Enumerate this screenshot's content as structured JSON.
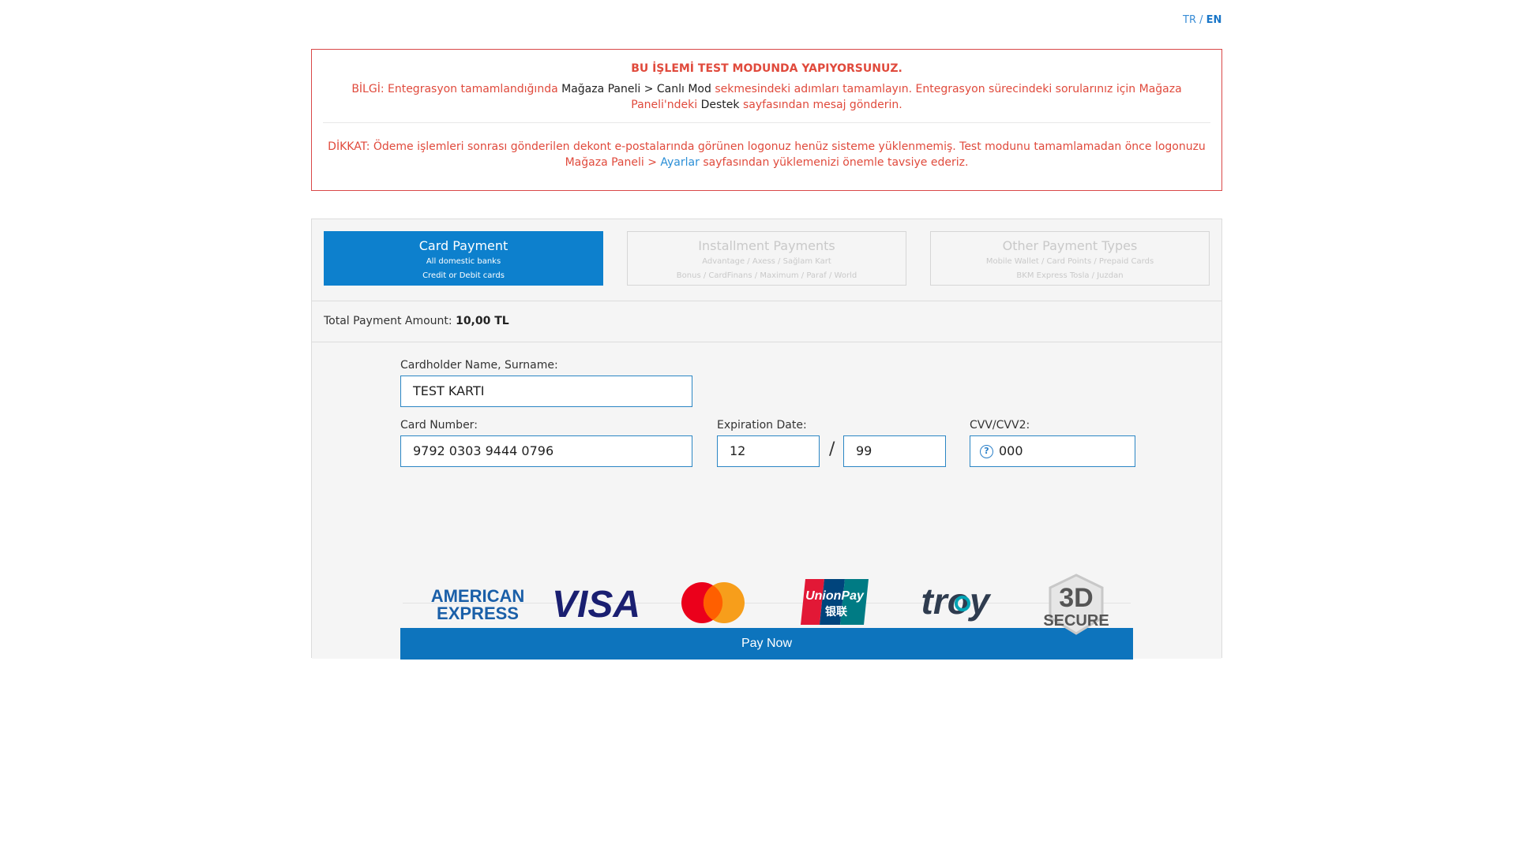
{
  "lang": {
    "tr": "TR",
    "sep": "/",
    "en": "EN"
  },
  "alert": {
    "title": "BU İŞLEMİ TEST MODUNDA YAPIYORSUNUZ.",
    "info_1": "BİLGİ: Entegrasyon tamamlandığında ",
    "info_link1": "Mağaza Paneli > Canlı Mod",
    "info_2": " sekmesindeki adımları tamamlayın. Entegrasyon sürecindeki sorularınız için Mağaza Paneli'ndeki ",
    "info_link2": "Destek",
    "info_3": " sayfasından mesaj gönderin.",
    "warn_1": "DİKKAT: Ödeme işlemleri sonrası gönderilen dekont e-postalarında görünen logonuz henüz sisteme yüklenmemiş. Test modunu tamamlamadan önce logonuzu Mağaza Paneli > ",
    "warn_link": "Ayarlar",
    "warn_2": " sayfasından yüklemenizi önemle tavsiye ederiz."
  },
  "tabs": [
    {
      "title": "Card Payment",
      "sub1": "All domestic banks",
      "sub2": "Credit or Debit cards"
    },
    {
      "title": "Installment Payments",
      "sub1": "Advantage / Axess / Sağlam Kart",
      "sub2": "Bonus / CardFinans / Maximum / Paraf / World"
    },
    {
      "title": "Other Payment Types",
      "sub1": "Mobile Wallet / Card Points / Prepaid Cards",
      "sub2": "BKM Express Tosla / Juzdan"
    }
  ],
  "amount": {
    "label": "Total Payment Amount:",
    "value": "10,00 TL"
  },
  "form": {
    "name_label": "Cardholder Name, Surname:",
    "name_value": "TEST KARTI",
    "card_label": "Card Number:",
    "card_value": "9792 0303 9444 0796",
    "exp_label": "Expiration Date:",
    "exp_month": "12",
    "exp_sep": "/",
    "exp_year": "99",
    "cvv_label": "CVV/CVV2:",
    "cvv_value": "000",
    "cvv_help": "?",
    "pay_label": "Pay Now"
  },
  "logos": {
    "amex_1": "AMERICAN",
    "amex_2": "EXPRESS",
    "visa": "VISA",
    "unionpay_1": "UnionPay",
    "unionpay_2": "银联",
    "troy": "troy",
    "secure_1": "3D",
    "secure_2": "SECURE",
    "colors": {
      "amex": "#1a5fa8",
      "visa": "#1a1f71",
      "mc_red": "#eb001b",
      "mc_orange": "#f79e1b",
      "troy": "#2f3c4f",
      "troy_accent": "#00a3b4"
    }
  }
}
